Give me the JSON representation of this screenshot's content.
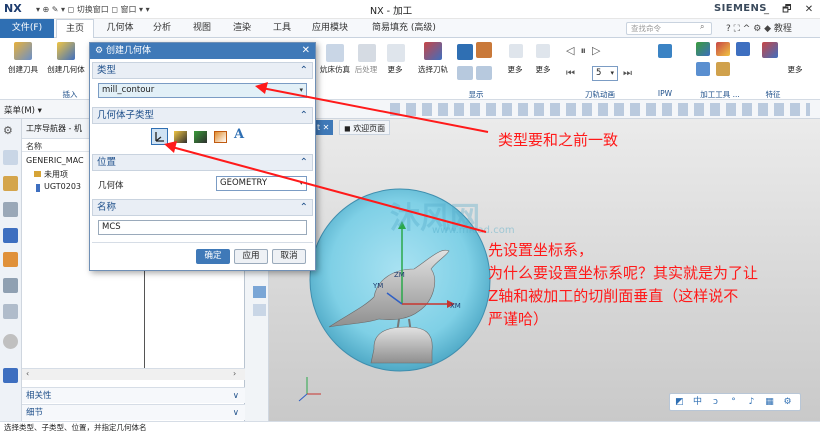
{
  "titlebar": {
    "logo": "NX",
    "quick_access": "▾ ⊕ ✎  ▾ ◻ 切换窗口 ◻ 窗口 ▾ ▾",
    "title": "NX - 加工",
    "brand": "SIEMENS",
    "controls": "_ 🗗 ✕"
  },
  "menubar": {
    "file": "文件(F)",
    "tabs": [
      "主页",
      "几何体",
      "分析",
      "视图",
      "渲染",
      "工具",
      "应用模块",
      "简易填充 (高级)"
    ],
    "search_placeholder": "查找命令",
    "right_icons": "? ⛶ ^ ⚙ ◆ 教程"
  },
  "ribbon": {
    "create_tool": "创建刀具",
    "create_geometry": "创建几何体",
    "group_insert": "插入",
    "frame_sim": "炕床仿真",
    "post": "后处理",
    "more1": "更多",
    "select_tool": "选择刀轨",
    "group_display": "显示",
    "more2": "更多",
    "more3": "更多",
    "speed_value": "5",
    "group_toolpath_anim": "刀轨动画",
    "group_ipw": "IPW",
    "group_process": "加工工具 ...",
    "more4": "更多",
    "group_feature": "特征"
  },
  "toolbar2": {
    "menu": "菜单(M) ▾"
  },
  "navigator": {
    "title": "工序导航器 - 机",
    "column": "名称",
    "rows": [
      "GENERIC_MAC",
      "未用项",
      "UGT0203"
    ],
    "bottom": [
      "相关性",
      "细节"
    ]
  },
  "graphics": {
    "tab_active": "t",
    "tab_welcome": "欢迎页面",
    "axis_zm": "ZM",
    "axis_xm": "XM",
    "axis_ym": "YM",
    "watermark": "沐风网",
    "watermark_url": "www.mfcad.com",
    "bottom_icons": [
      "◩",
      "中",
      "ↄ",
      "°",
      "♪",
      "▦",
      "⚙"
    ]
  },
  "dialog": {
    "title": "创建几何体",
    "sec_type": "类型",
    "type_value": "mill_contour",
    "sec_subtype": "几何体子类型",
    "sec_location": "位置",
    "geometry_label": "几何体",
    "geometry_value": "GEOMETRY",
    "sec_name": "名称",
    "name_value": "MCS",
    "ok": "确定",
    "apply": "应用",
    "cancel": "取消"
  },
  "annotations": {
    "a1": "类型要和之前一致",
    "a2_l1": "先设置坐标系，",
    "a2_l2": "为什么要设置坐标系呢？其实就是为了让",
    "a2_l3": "Z轴和被加工的切削面垂直（这样说不",
    "a2_l4": "严谨哈）"
  },
  "statusbar": {
    "text": "选择类型、子类型、位置，并指定几何体名"
  },
  "colors": {
    "accent": "#3f79b8",
    "annotation": "#ff1a1a",
    "model": "#7fd0e6"
  }
}
